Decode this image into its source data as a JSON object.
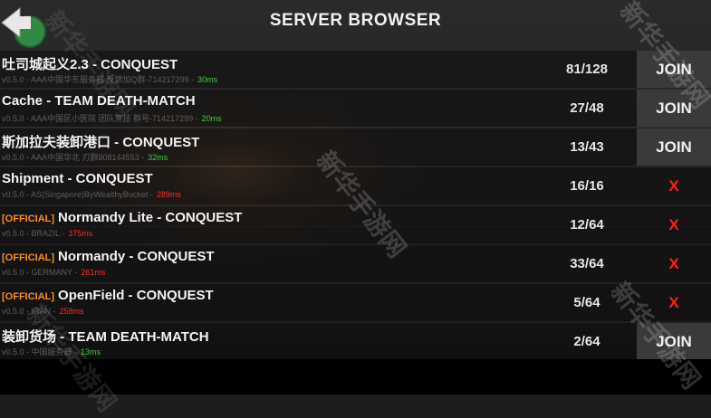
{
  "header": {
    "title": "SERVER BROWSER"
  },
  "colors": {
    "ping_good": "#3ecf3e",
    "ping_bad": "#ff2a2a",
    "official": "#ff8c1a",
    "full": "#ff1e1e"
  },
  "servers": [
    {
      "tag": "",
      "name": "吐司城起义2.3 - CONQUEST",
      "info": "v0.5.0 - AAA中国华东服务器 反馈加Q群-714217299 -",
      "ping": "30ms",
      "ping_ok": true,
      "players": "81/128",
      "action": "JOIN"
    },
    {
      "tag": "",
      "name": "Cache - TEAM DEATH-MATCH",
      "info": "v0.5.0 - AAA中国区小医院 团队竞技 群号-714217299 -",
      "ping": "20ms",
      "ping_ok": true,
      "players": "27/48",
      "action": "JOIN"
    },
    {
      "tag": "",
      "name": "斯加拉夫装卸港口 - CONQUEST",
      "info": "v0.5.0 - AAA中国华北 刃群808144553 -",
      "ping": "32ms",
      "ping_ok": true,
      "players": "13/43",
      "action": "JOIN"
    },
    {
      "tag": "",
      "name": "Shipment - CONQUEST",
      "info": "v0.5.0 - AS(Singapore)ByWealthyBucket -",
      "ping": "289ms",
      "ping_ok": false,
      "players": "16/16",
      "action": "X"
    },
    {
      "tag": "[OFFICIAL]",
      "name": "Normandy Lite - CONQUEST",
      "info": "v0.5.0 - BRAZIL -",
      "ping": "375ms",
      "ping_ok": false,
      "players": "12/64",
      "action": "X"
    },
    {
      "tag": "[OFFICIAL]",
      "name": "Normandy - CONQUEST",
      "info": "v0.5.0 - GERMANY -",
      "ping": "261ms",
      "ping_ok": false,
      "players": "33/64",
      "action": "X"
    },
    {
      "tag": "[OFFICIAL]",
      "name": "OpenField - CONQUEST",
      "info": "v0.5.0 - IRAN -",
      "ping": "258ms",
      "ping_ok": false,
      "players": "5/64",
      "action": "X"
    },
    {
      "tag": "",
      "name": "装卸货场 - TEAM DEATH-MATCH",
      "info": "v0.5.0 - 中国服务器 -",
      "ping": "13ms",
      "ping_ok": true,
      "players": "2/64",
      "action": "JOIN"
    }
  ],
  "watermarks": [
    "新华手游网",
    "新华手游网",
    "新华手游网",
    "新华手游网",
    "新华手游网"
  ]
}
